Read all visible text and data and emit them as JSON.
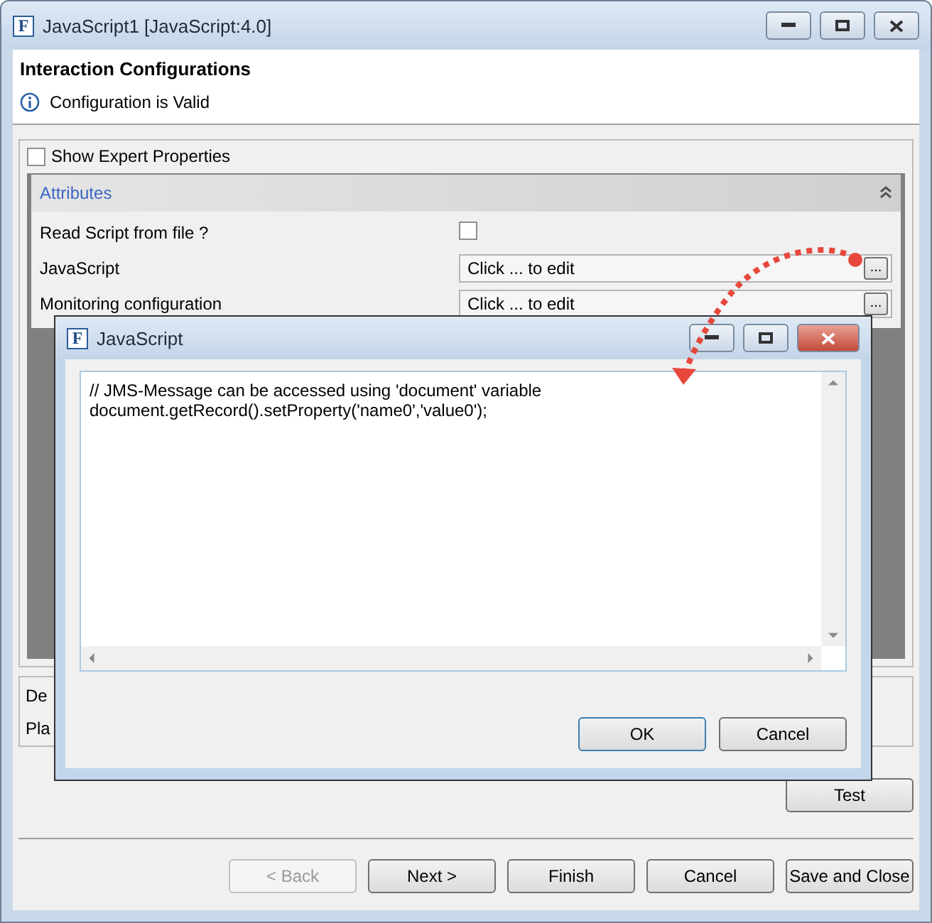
{
  "window": {
    "title": "JavaScript1 [JavaScript:4.0]",
    "logo": "F"
  },
  "header": {
    "title": "Interaction Configurations",
    "message": "Configuration is Valid"
  },
  "expert": {
    "label": "Show Expert Properties",
    "checked": false
  },
  "attributes": {
    "title": "Attributes",
    "expanded": true,
    "rows": [
      {
        "kind": "checkbox",
        "label": "Read Script from file ?",
        "checked": false
      },
      {
        "kind": "field",
        "label": "JavaScript",
        "value": "Click ... to edit",
        "button": "..."
      },
      {
        "kind": "field",
        "label": "Monitoring configuration",
        "value": "Click ... to edit",
        "button": "..."
      }
    ]
  },
  "lower_panel": {
    "lines": [
      "De",
      "Pla"
    ]
  },
  "test_button": "Test",
  "buttons": [
    {
      "label": "< Back",
      "disabled": true
    },
    {
      "label": "Next >",
      "disabled": false
    },
    {
      "label": "Finish",
      "disabled": false
    },
    {
      "label": "Cancel",
      "disabled": false
    },
    {
      "label": "Save and Close",
      "disabled": false
    }
  ],
  "dialog": {
    "title": "JavaScript",
    "logo": "F",
    "code": [
      "// JMS-Message can be accessed using 'document' variable",
      "document.getRecord().setProperty('name0','value0');"
    ],
    "buttons": [
      {
        "label": "OK",
        "default": true
      },
      {
        "label": "Cancel",
        "default": false
      }
    ]
  }
}
